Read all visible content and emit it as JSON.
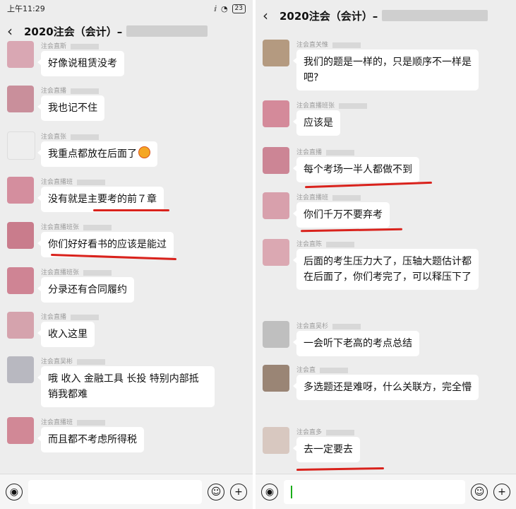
{
  "status": {
    "time": "上午11:29",
    "battery": "23"
  },
  "left": {
    "title": "2020注会（会计）–",
    "messages": [
      {
        "sender": "注会直斯",
        "text": "好像说租赁没考",
        "avatar": "#d9a7b3"
      },
      {
        "sender": "注会直播",
        "text": "我也记不住",
        "avatar": "#c98f9b"
      },
      {
        "sender": "注会直张",
        "text": "我重点都放在后面了",
        "avatar": "#eeeeee",
        "emoji": "face-emoji-icon"
      },
      {
        "sender": "注会直播班",
        "text": "没有就是主要考的前７章",
        "avatar": "#d48e9e"
      },
      {
        "sender": "注会直播班张",
        "text": "你们好好看书的应该是能过",
        "avatar": "#c97c8c"
      },
      {
        "sender": "注会直播班张",
        "text": "分录还有合同履约",
        "avatar": "#cf8494"
      },
      {
        "sender": "注会直播",
        "text": "收入这里",
        "avatar": "#d5a3ad"
      },
      {
        "sender": "注会直吴彬",
        "text": "哦 收入 金融工具 长投 特别内部抵销我都难",
        "avatar": "#b8b8c0"
      },
      {
        "sender": "注会直播班",
        "text": "而且都不考虑所得税",
        "avatar": "#d18896"
      }
    ]
  },
  "right": {
    "title": "2020注会（会计）–",
    "messages": [
      {
        "sender": "注会直关惟",
        "text": "我们的题是一样的，只是顺序不一样是吧?",
        "avatar": "#b49a80"
      },
      {
        "sender": "注会直播班张",
        "text": "应该是",
        "avatar": "#d48a9a"
      },
      {
        "sender": "注会直播",
        "text": "每个考场一半人都做不到",
        "avatar": "#cc8595"
      },
      {
        "sender": "注会直播班",
        "text": "你们千万不要弃考",
        "avatar": "#d8a0ac"
      },
      {
        "sender": "注会直陈",
        "text": "后面的考生压力大了，压轴大题估计都在后面了，你们考完了，可以释压下了",
        "avatar": "#dba8b2"
      },
      {
        "sender": "注会直吴杉",
        "text": "一会听下老高的考点总结",
        "avatar": "#bfbfbf"
      },
      {
        "sender": "注会直",
        "text": "多选题还是难呀，什么关联方，完全懵",
        "avatar": "#9a8575"
      },
      {
        "sender": "注会直多",
        "text": "去一定要去",
        "avatar": "#d8c8c0"
      }
    ]
  },
  "accent_colors": {
    "underline": "#d9221c",
    "cursor": "#1aad19"
  },
  "icons": [
    "chevron-left-icon",
    "voice-icon",
    "emoji-icon",
    "plus-icon"
  ]
}
